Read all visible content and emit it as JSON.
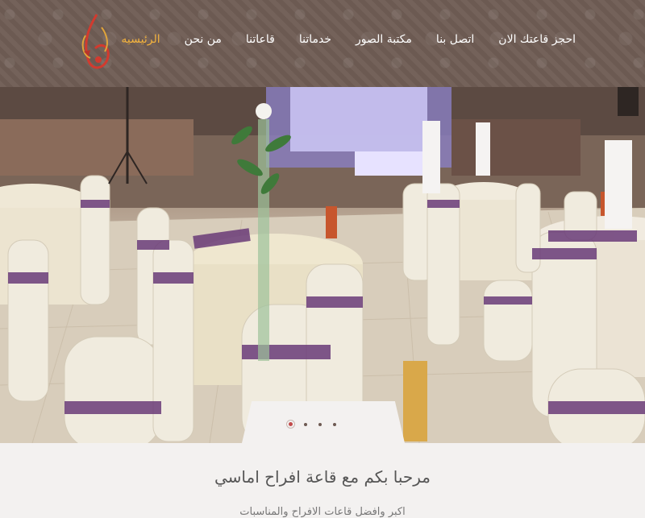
{
  "nav": {
    "items": [
      {
        "label": "الرئيسيه",
        "active": true
      },
      {
        "label": "من نحن"
      },
      {
        "label": "قاعاتنا"
      },
      {
        "label": "خدماتنا"
      },
      {
        "label": "مكتبة الصور"
      },
      {
        "label": "اتصل بنا"
      },
      {
        "label": "احجز قاعتك الان"
      }
    ]
  },
  "slider": {
    "slide_count": 4,
    "active_index": 0
  },
  "content": {
    "welcome_title": "مرحبا بكم مع قاعة افراح اماسي",
    "subtitle": "اكبر وافضل قاعات الافراح والمناسبات"
  },
  "colors": {
    "header_bg": "#6f5d55",
    "nav_active": "#f2b23e",
    "nav_text": "#ffffff",
    "ribbon_purple": "#6a3b78",
    "page_bg": "#f3f1f0"
  }
}
